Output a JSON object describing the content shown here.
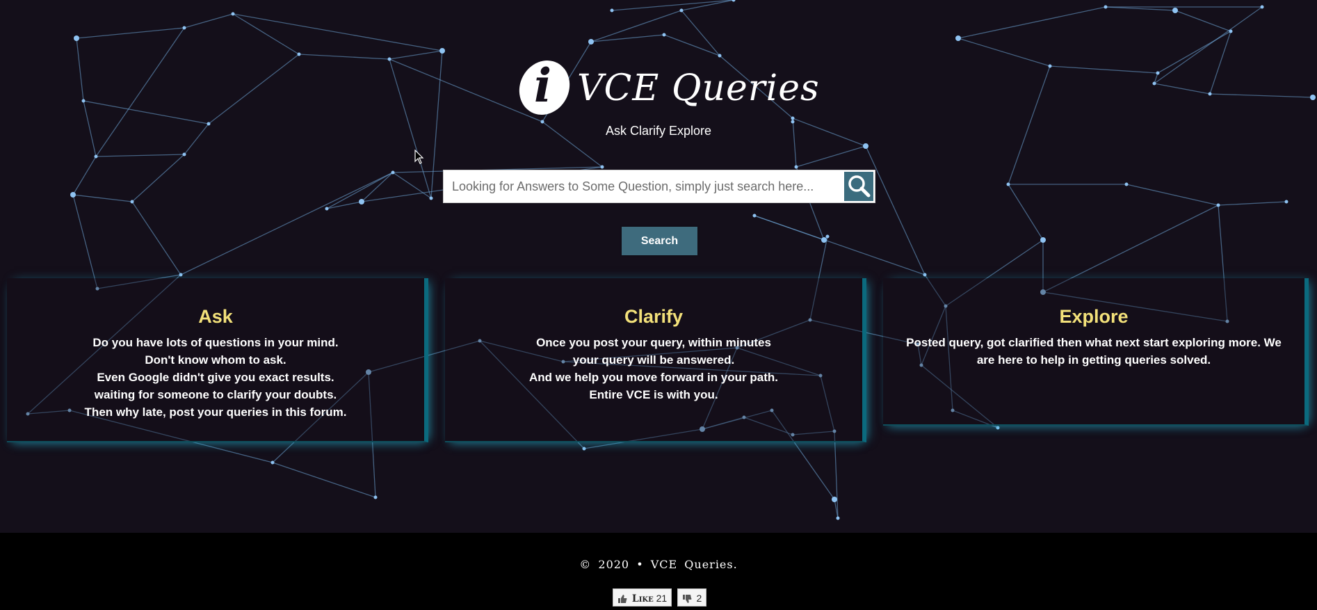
{
  "brand": {
    "logo_letter": "i",
    "name": "VCE Queries",
    "tagline": "Ask Clarify Explore"
  },
  "search": {
    "placeholder": "Looking for Answers to Some Question, simply just search here...",
    "value": "",
    "icon": "search-icon",
    "button_label": "Search"
  },
  "cards": [
    {
      "title": "Ask",
      "lines": [
        "Do you have lots of questions in your mind.",
        "Don't know whom to ask.",
        "Even Google didn't give you exact results.",
        "waiting for someone to clarify your doubts.",
        "Then why late, post your queries in this forum."
      ]
    },
    {
      "title": "Clarify",
      "lines": [
        "Once you post your query, within minutes",
        "your query will be answered.",
        "And we help you move forward in your path.",
        "Entire VCE is with you."
      ]
    },
    {
      "title": "Explore",
      "lines": [
        "Posted query, got clarified then what next start exploring more. We are here to help in getting queries solved."
      ]
    }
  ],
  "footer": {
    "copyright": "© 2020 • VCE Queries.",
    "like_label": "Like",
    "like_count": "21",
    "dislike_count": "2"
  },
  "colors": {
    "background": "#140f1a",
    "accent_title": "#f3e17a",
    "button": "#3e6b7d",
    "card_glow": "#0b6a7e",
    "network_lines": "#6fa7d8"
  }
}
